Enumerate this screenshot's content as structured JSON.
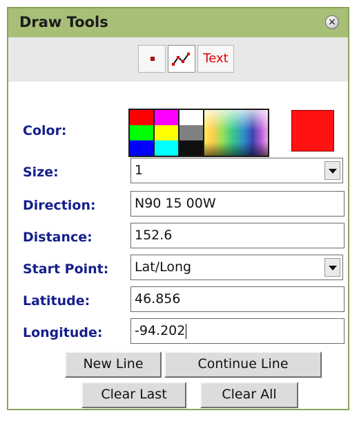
{
  "panel": {
    "title": "Draw Tools"
  },
  "toolbar": {
    "tools": [
      {
        "icon": "point-icon"
      },
      {
        "icon": "polyline-icon"
      },
      {
        "label": "Text"
      }
    ]
  },
  "form": {
    "color_label": "Color:",
    "color": {
      "selected": "#ff1212"
    },
    "palette": [
      "#ff0000",
      "#ff00ff",
      "#ffffff",
      "#00ff00",
      "#ffff00",
      "#808080",
      "#0000ff",
      "#00ffff",
      "#101010"
    ],
    "size_label": "Size:",
    "size_value": "1",
    "direction_label": "Direction:",
    "direction_value": "N90 15 00W",
    "distance_label": "Distance:",
    "distance_value": "152.6",
    "start_point_label": "Start Point:",
    "start_point_value": "Lat/Long",
    "latitude_label": "Latitude:",
    "latitude_value": "46.856",
    "longitude_label": "Longitude:",
    "longitude_value": "-94.202"
  },
  "buttons": {
    "new_line": "New Line",
    "continue_line": "Continue Line",
    "clear_last": "Clear Last",
    "clear_all": "Clear All"
  }
}
